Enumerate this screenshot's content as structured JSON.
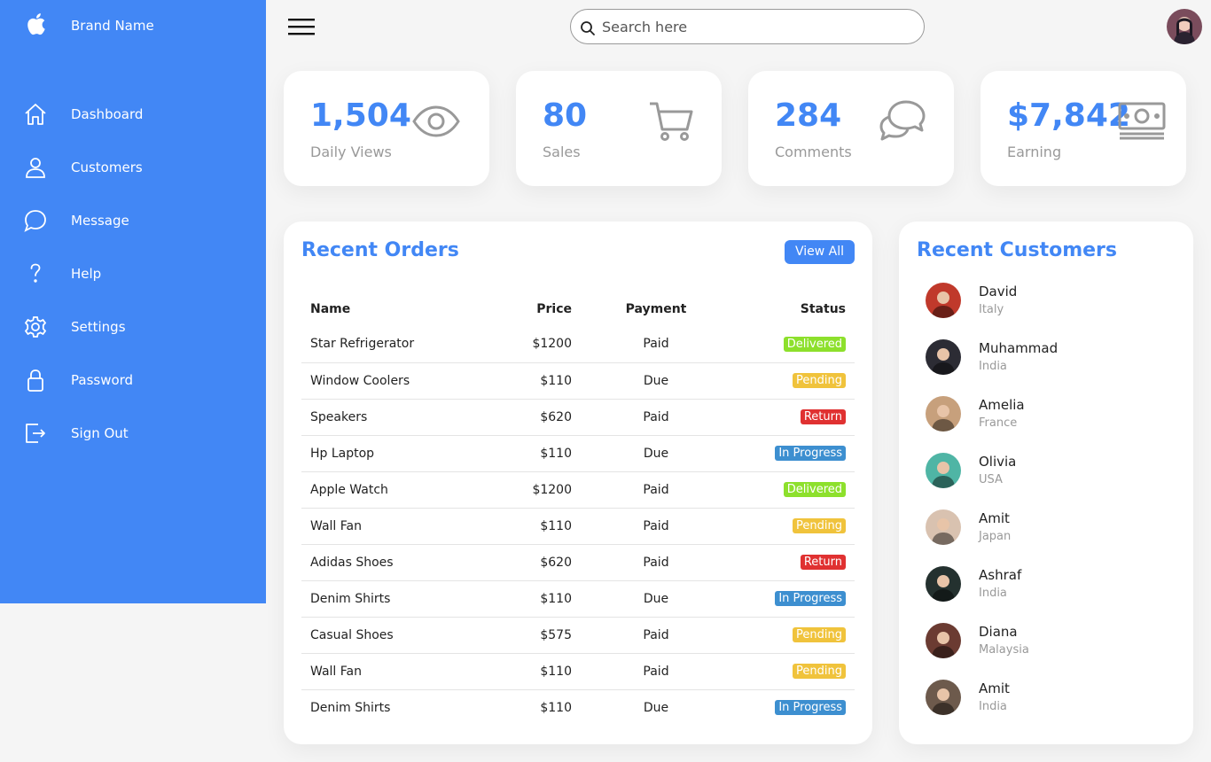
{
  "sidebar": {
    "brand": "Brand Name",
    "items": [
      {
        "label": "Dashboard",
        "icon": "home-icon"
      },
      {
        "label": "Customers",
        "icon": "person-icon"
      },
      {
        "label": "Message",
        "icon": "chat-icon"
      },
      {
        "label": "Help",
        "icon": "help-icon"
      },
      {
        "label": "Settings",
        "icon": "gear-icon"
      },
      {
        "label": "Password",
        "icon": "lock-icon"
      },
      {
        "label": "Sign Out",
        "icon": "sign-out-icon"
      }
    ]
  },
  "topbar": {
    "search_placeholder": "Search here"
  },
  "cards": [
    {
      "number": "1,504",
      "caption": "Daily Views",
      "icon": "eye-icon"
    },
    {
      "number": "80",
      "caption": "Sales",
      "icon": "cart-icon"
    },
    {
      "number": "284",
      "caption": "Comments",
      "icon": "chat-icon"
    },
    {
      "number": "$7,842",
      "caption": "Earning",
      "icon": "cash-icon"
    }
  ],
  "orders": {
    "title": "Recent Orders",
    "view_all": "View All",
    "headers": {
      "name": "Name",
      "price": "Price",
      "payment": "Payment",
      "status": "Status"
    },
    "rows": [
      {
        "name": "Star Refrigerator",
        "price": "$1200",
        "payment": "Paid",
        "status": "Delivered"
      },
      {
        "name": "Window Coolers",
        "price": "$110",
        "payment": "Due",
        "status": "Pending"
      },
      {
        "name": "Speakers",
        "price": "$620",
        "payment": "Paid",
        "status": "Return"
      },
      {
        "name": "Hp Laptop",
        "price": "$110",
        "payment": "Due",
        "status": "In Progress"
      },
      {
        "name": "Apple Watch",
        "price": "$1200",
        "payment": "Paid",
        "status": "Delivered"
      },
      {
        "name": "Wall Fan",
        "price": "$110",
        "payment": "Paid",
        "status": "Pending"
      },
      {
        "name": "Adidas Shoes",
        "price": "$620",
        "payment": "Paid",
        "status": "Return"
      },
      {
        "name": "Denim Shirts",
        "price": "$110",
        "payment": "Due",
        "status": "In Progress"
      },
      {
        "name": "Casual Shoes",
        "price": "$575",
        "payment": "Paid",
        "status": "Pending"
      },
      {
        "name": "Wall Fan",
        "price": "$110",
        "payment": "Paid",
        "status": "Pending"
      },
      {
        "name": "Denim Shirts",
        "price": "$110",
        "payment": "Due",
        "status": "In Progress"
      }
    ]
  },
  "status_colors": {
    "Delivered": "#8de02c",
    "Pending": "#f0c33c",
    "Return": "#e03131",
    "In Progress": "#3d8fd0"
  },
  "customers": {
    "title": "Recent Customers",
    "list": [
      {
        "name": "David",
        "country": "Italy",
        "color": "#c0392b"
      },
      {
        "name": "Muhammad",
        "country": "India",
        "color": "#2c2c34"
      },
      {
        "name": "Amelia",
        "country": "France",
        "color": "#c7a07c"
      },
      {
        "name": "Olivia",
        "country": "USA",
        "color": "#4fb5a5"
      },
      {
        "name": "Amit",
        "country": "Japan",
        "color": "#d9c2b0"
      },
      {
        "name": "Ashraf",
        "country": "India",
        "color": "#24312f"
      },
      {
        "name": "Diana",
        "country": "Malaysia",
        "color": "#6b3b32"
      },
      {
        "name": "Amit",
        "country": "India",
        "color": "#6d5a4c"
      }
    ]
  },
  "theme": {
    "accent": "#4287f5",
    "muted": "#999999"
  }
}
